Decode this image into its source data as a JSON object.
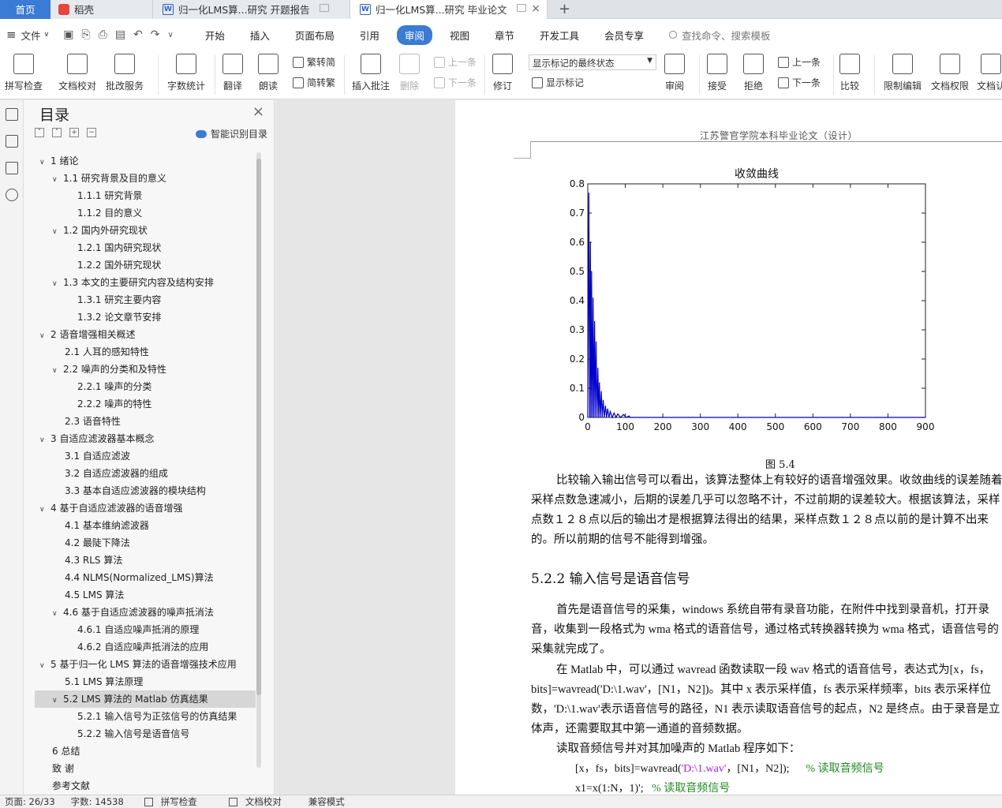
{
  "tabs": {
    "home": "首页",
    "daoke": "稻壳",
    "doc1": "归一化LMS算...研究 开题报告",
    "doc2": "归一化LMS算...研究 毕业论文",
    "doc_icon": "W",
    "add": "+"
  },
  "menu": {
    "file": "文件",
    "tabs": [
      "开始",
      "插入",
      "页面布局",
      "引用",
      "审阅",
      "视图",
      "章节",
      "开发工具",
      "会员专享"
    ],
    "active_tab": "审阅",
    "search_placeholder": "查找命令、搜索模板"
  },
  "ribbon": {
    "spell_check": "拼写检查",
    "doc_proofread": "文档校对",
    "batch_service": "批改服务",
    "word_count": "字数统计",
    "translate": "翻译",
    "read_aloud": "朗读",
    "trad_simp": "繁转简",
    "simp_trad": "简转繁",
    "insert_comment": "插入批注",
    "delete": "删除",
    "prev_comment": "上一条",
    "next_comment": "下一条",
    "track_changes": "修订",
    "display_state": "显示标记的最终状态",
    "show_markup": "显示标记",
    "review": "审阅",
    "accept": "接受",
    "reject": "拒绝",
    "prev": "上一条",
    "next": "下一条",
    "compare": "比较",
    "restrict_edit": "限制编辑",
    "doc_rights": "文档权限",
    "doc_cert": "文档认"
  },
  "toc": {
    "title": "目录",
    "smart": "智能识别目录",
    "items": [
      {
        "text": "1  绪论",
        "level": 0,
        "caret": "v"
      },
      {
        "text": "1.1  研究背景及目的意义",
        "level": 1,
        "caret": "v"
      },
      {
        "text": "1.1.1  研究背景",
        "level": 2,
        "caret": ""
      },
      {
        "text": "1.1.2  目的意义",
        "level": 2,
        "caret": ""
      },
      {
        "text": "1.2  国内外研究现状",
        "level": 1,
        "caret": "v"
      },
      {
        "text": "1.2.1  国内研究现状",
        "level": 2,
        "caret": ""
      },
      {
        "text": "1.2.2  国外研究现状",
        "level": 2,
        "caret": ""
      },
      {
        "text": "1.3  本文的主要研究内容及结构安排",
        "level": 1,
        "caret": "v"
      },
      {
        "text": "1.3.1  研究主要内容",
        "level": 2,
        "caret": ""
      },
      {
        "text": "1.3.2  论文章节安排",
        "level": 2,
        "caret": ""
      },
      {
        "text": "2  语音增强相关概述",
        "level": 0,
        "caret": "v"
      },
      {
        "text": "2.1  人耳的感知特性",
        "level": 1,
        "caret": ""
      },
      {
        "text": "2.2  噪声的分类和及特性",
        "level": 1,
        "caret": "v"
      },
      {
        "text": "2.2.1  噪声的分类",
        "level": 2,
        "caret": ""
      },
      {
        "text": "2.2.2  噪声的特性",
        "level": 2,
        "caret": ""
      },
      {
        "text": "2.3 语音特性",
        "level": 1,
        "caret": ""
      },
      {
        "text": "3  自适应滤波器基本概念",
        "level": 0,
        "caret": "v"
      },
      {
        "text": "3.1 自适应滤波",
        "level": 1,
        "caret": ""
      },
      {
        "text": "3.2 自适应滤波器的组成",
        "level": 1,
        "caret": ""
      },
      {
        "text": "3.3 基本自适应滤波器的模块结构",
        "level": 1,
        "caret": ""
      },
      {
        "text": "4  基于自适应滤波器的语音增强",
        "level": 0,
        "caret": "v"
      },
      {
        "text": "4.1  基本维纳滤波器",
        "level": 1,
        "caret": ""
      },
      {
        "text": "4.2  最陡下降法",
        "level": 1,
        "caret": ""
      },
      {
        "text": "4.3 RLS 算法",
        "level": 1,
        "caret": ""
      },
      {
        "text": "4.4 NLMS(Normalized_LMS)算法",
        "level": 1,
        "caret": ""
      },
      {
        "text": "4.5 LMS 算法",
        "level": 1,
        "caret": ""
      },
      {
        "text": "4.6  基于自适应滤波器的噪声抵消法",
        "level": 1,
        "caret": "v"
      },
      {
        "text": "4.6.1 自适应噪声抵消的原理",
        "level": 2,
        "caret": ""
      },
      {
        "text": "4.6.2 自适应噪声抵消法的应用",
        "level": 2,
        "caret": ""
      },
      {
        "text": "5  基于归一化 LMS 算法的语音增强技术应用",
        "level": 0,
        "caret": "v"
      },
      {
        "text": "5.1 LMS 算法原理",
        "level": 1,
        "caret": ""
      },
      {
        "text": "5.2 LMS 算法的 Matlab 仿真结果",
        "level": 1,
        "caret": "v"
      },
      {
        "text": "5.2.1  输入信号为正弦信号的仿真结果",
        "level": 2,
        "caret": ""
      },
      {
        "text": "5.2.2  输入信号是语音信号",
        "level": 2,
        "caret": ""
      },
      {
        "text": "6  总结",
        "level": 0,
        "caret": ""
      },
      {
        "text": "致   谢",
        "level": 0,
        "caret": ""
      },
      {
        "text": "参考文献",
        "level": 0,
        "caret": ""
      }
    ],
    "selected_index": 31
  },
  "doc": {
    "header": "江苏警官学院本科毕业论文（设计）",
    "fig_caption": "图 5.4",
    "para1": "比较输入输出信号可以看出，该算法整体上有较好的语音增强效果。收敛曲线的误差随着采样点数急速减小，后期的误差几乎可以忽略不计，不过前期的误差较大。根据该算法，采样点数１２８点以后的输出才是根据算法得出的结果，采样点数１２８点以前的是计算不出来的。所以前期的信号不能得到增强。",
    "section": "5.2.2  输入信号是语音信号",
    "para2": "首先是语音信号的采集，windows 系统自带有录音功能，在附件中找到录音机，打开录音，收集到一段格式为 wma 格式的语音信号，通过格式转换器转换为 wma 格式，语音信号的采集就完成了。",
    "para3": "在 Matlab 中，可以通过 wavread 函数读取一段 wav 格式的语音信号，表达式为[x，fs，bits]=wavread('D:\\1.wav'，[N1，N2])。其中 x 表示采样值，fs 表示采样频率，bits 表示采样位数，'D:\\1.wav'表示语音信号的路径，N1 表示读取语音信号的起点，N2 是终点。由于录音是立体声，还需要取其中第一通道的音频数据。",
    "para4": "读取音频信号并对其加噪声的 Matlab 程序如下：",
    "code1_a": "[x，fs，bits]=wavread(",
    "code1_str": "'D:\\1.wav'",
    "code1_b": "，[N1，N2]);",
    "code1_cmt": "%    读取音频信号",
    "code2_a": "x1=x(1:N，1)';",
    "code2_cmt": "%    读取音频信号"
  },
  "chart_data": {
    "type": "line",
    "title": "收敛曲线",
    "xlim": [
      0,
      900
    ],
    "ylim": [
      0,
      0.8
    ],
    "xticks": [
      0,
      100,
      200,
      300,
      400,
      500,
      600,
      700,
      800,
      900
    ],
    "yticks": [
      0,
      0.1,
      0.2,
      0.3,
      0.4,
      0.5,
      0.6,
      0.7,
      0.8
    ],
    "xtick_labels": [
      "0",
      "100",
      "200",
      "300",
      "400",
      "500",
      "600",
      "700",
      "800",
      "900"
    ],
    "ytick_labels": [
      "0",
      "0.1",
      "0.2",
      "0.3",
      "0.4",
      "0.5",
      "0.6",
      "0.7",
      "0.8"
    ],
    "color": "#0000cc",
    "peaks": [
      [
        3,
        0.77
      ],
      [
        7,
        0.6
      ],
      [
        10,
        0.5
      ],
      [
        14,
        0.41
      ],
      [
        18,
        0.33
      ],
      [
        22,
        0.26
      ],
      [
        27,
        0.17
      ],
      [
        31,
        0.12
      ],
      [
        36,
        0.09
      ],
      [
        41,
        0.06
      ],
      [
        47,
        0.04
      ],
      [
        53,
        0.03
      ],
      [
        60,
        0.02
      ],
      [
        70,
        0.015
      ],
      [
        80,
        0.012
      ],
      [
        95,
        0.01
      ],
      [
        110,
        0.005
      ]
    ]
  },
  "status": {
    "page": "页面: 26/33",
    "words": "字数: 14538",
    "spell": "拼写检查",
    "proof": "文档校对",
    "compat": "兼容模式"
  }
}
